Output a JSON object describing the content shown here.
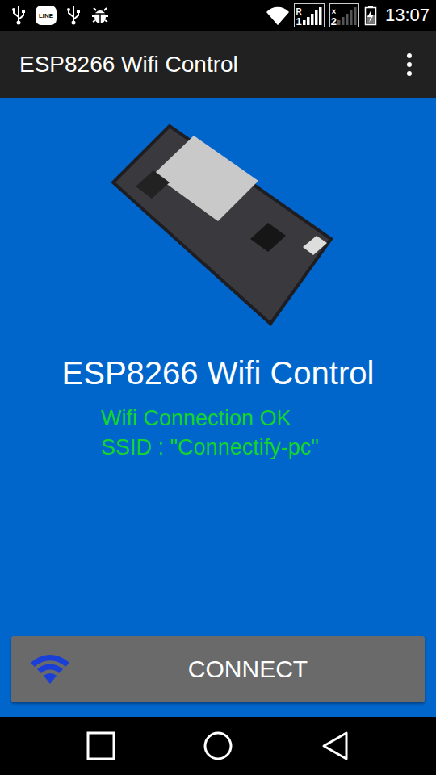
{
  "status_bar": {
    "line_badge": "LINE",
    "wifi": {
      "level": 1
    },
    "sims": [
      {
        "label": "1",
        "badge": "R",
        "level": 1
      },
      {
        "label": "2",
        "badge": "×",
        "level": 0
      }
    ],
    "battery": {
      "level": 0.5,
      "charging": true
    },
    "time": "13:07"
  },
  "app_bar": {
    "title": "ESP8266 Wifi Control"
  },
  "heading": "ESP8266 Wifi Control",
  "connection": {
    "connected": true,
    "lines": [
      "Wifi Connection OK",
      "SSID : \"Connectify-pc\""
    ]
  },
  "button": {
    "label": "CONNECT"
  }
}
